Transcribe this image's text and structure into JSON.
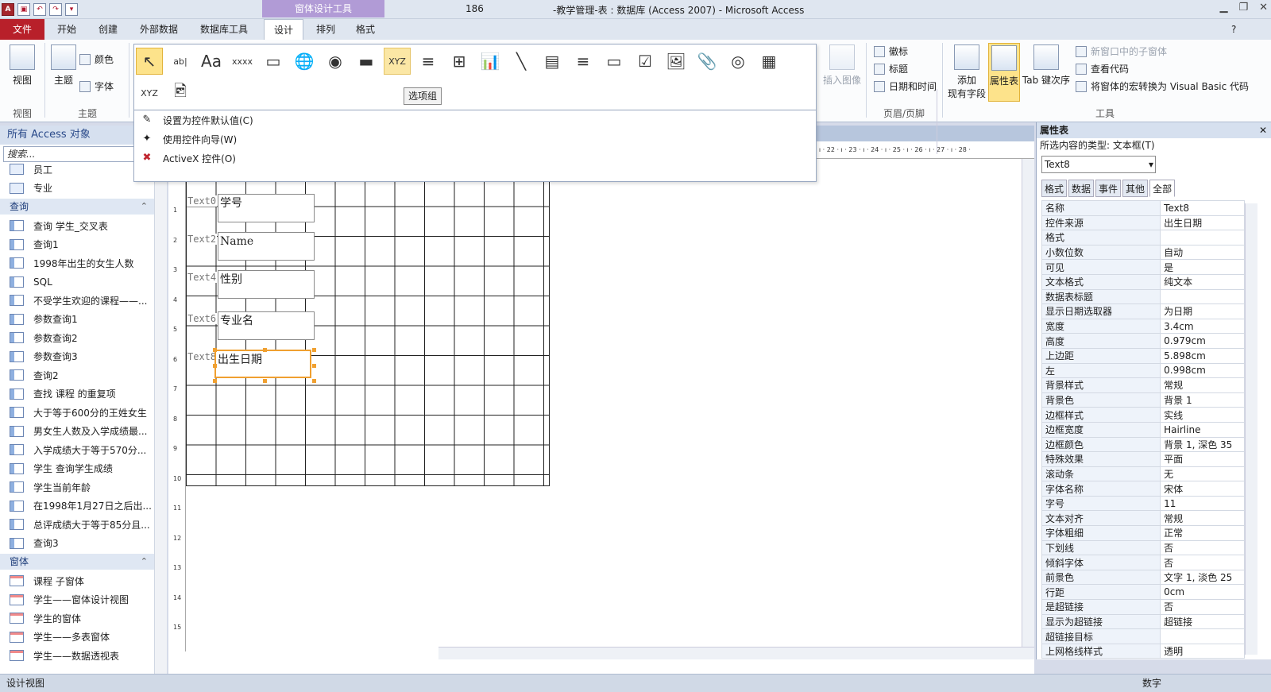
{
  "titlebar": {
    "context_tab": "窗体设计工具",
    "left_fragment": "186",
    "title": "-教学管理-表 : 数据库 (Access 2007)  -  Microsoft Access",
    "qat_app": "A",
    "min": "▁",
    "max": "❐",
    "close": "✕"
  },
  "tabs": {
    "file": "文件",
    "items": [
      "开始",
      "创建",
      "外部数据",
      "数据库工具",
      "设计",
      "排列",
      "格式"
    ],
    "help": "?"
  },
  "ribbon": {
    "view_label": "视图",
    "theme_label": "主题",
    "color_label": "颜色",
    "font_label": "字体",
    "group_view": "视图",
    "group_theme": "主题",
    "insert_image": "插入图像",
    "header_items": [
      "徽标",
      "标题",
      "日期和时间"
    ],
    "group_header": "页眉/页脚",
    "add_fields": "添加\n现有字段",
    "add_fields_line1": "添加",
    "add_fields_line2": "现有字段",
    "property_sheet": "属性表",
    "tab_order": "Tab 键次序",
    "tools_items": [
      "新窗口中的子窗体",
      "查看代码",
      "将窗体的宏转换为 Visual Basic 代码"
    ],
    "group_tools": "工具"
  },
  "gallery": {
    "controls": [
      "↖",
      "ab|",
      "Aa",
      "xxxx",
      "▭",
      "🌐",
      "◉",
      "▬",
      "XYZ",
      "≡",
      "⊞",
      "📊",
      "╲",
      "▤",
      "≡",
      "▭",
      "☑",
      "🖼",
      "📎",
      "◎",
      "▦",
      "XYZ",
      "🖻"
    ],
    "tooltip": "选项组"
  },
  "dropdown_menu": [
    {
      "icon": "✎",
      "label": "设置为控件默认值(C)"
    },
    {
      "icon": "✦",
      "label": "使用控件向导(W)"
    },
    {
      "icon": "✖",
      "label": "ActiveX 控件(O)"
    }
  ],
  "nav": {
    "header": "所有 Access 对象",
    "search_placeholder": "搜索...",
    "tables": [
      "员工",
      "专业"
    ],
    "queries_header": "查询",
    "queries": [
      "查询 学生_交叉表",
      "查询1",
      "1998年出生的女生人数",
      "SQL",
      "不受学生欢迎的课程——...",
      "参数查询1",
      "参数查询2",
      "参数查询3",
      "查询2",
      "查找 课程 的重复项",
      "大于等于600分的王姓女生",
      "男女生人数及入学成绩最...",
      "入学成绩大于等于570分...",
      "学生 查询学生成绩",
      "学生当前年龄",
      "在1998年1月27日之后出...",
      "总评成绩大于等于85分且...",
      "查询3"
    ],
    "forms_header": "窗体",
    "forms": [
      "课程 子窗体",
      "学生——窗体设计视图",
      "学生的窗体",
      "学生——多表窗体",
      "学生——数据透视表"
    ],
    "chevron": "≈"
  },
  "design": {
    "ruler_h": "· 21 · ı · 22 · ı · 23 · ı · 24 · ı · 25 · ı · 26 · ı · 27 · ı · 28 ·",
    "ruler_v": [
      "1",
      "2",
      "3",
      "4",
      "5",
      "6",
      "7",
      "8",
      "9",
      "10",
      "11",
      "12",
      "13",
      "14",
      "15"
    ],
    "fields": [
      {
        "label": "Text0",
        "value": "学号"
      },
      {
        "label": "Text2",
        "value": "Name"
      },
      {
        "label": "Text4",
        "value": "性别"
      },
      {
        "label": "Text6",
        "value": "专业名"
      },
      {
        "label": "Text8",
        "value": "出生日期"
      }
    ]
  },
  "properties": {
    "title": "属性表",
    "close": "✕",
    "selection_type": "所选内容的类型: 文本框(T)",
    "selected": "Text8",
    "tabs": [
      "格式",
      "数据",
      "事件",
      "其他",
      "全部"
    ],
    "rows": [
      [
        "名称",
        "Text8"
      ],
      [
        "控件来源",
        "出生日期"
      ],
      [
        "格式",
        ""
      ],
      [
        "小数位数",
        "自动"
      ],
      [
        "可见",
        "是"
      ],
      [
        "文本格式",
        "纯文本"
      ],
      [
        "数据表标题",
        ""
      ],
      [
        "显示日期选取器",
        "为日期"
      ],
      [
        "宽度",
        "3.4cm"
      ],
      [
        "高度",
        "0.979cm"
      ],
      [
        "上边距",
        "5.898cm"
      ],
      [
        "左",
        "0.998cm"
      ],
      [
        "背景样式",
        "常规"
      ],
      [
        "背景色",
        "背景 1"
      ],
      [
        "边框样式",
        "实线"
      ],
      [
        "边框宽度",
        "Hairline"
      ],
      [
        "边框颜色",
        "背景 1, 深色 35"
      ],
      [
        "特殊效果",
        "平面"
      ],
      [
        "滚动条",
        "无"
      ],
      [
        "字体名称",
        "宋体"
      ],
      [
        "字号",
        "11"
      ],
      [
        "文本对齐",
        "常规"
      ],
      [
        "字体粗细",
        "正常"
      ],
      [
        "下划线",
        "否"
      ],
      [
        "倾斜字体",
        "否"
      ],
      [
        "前景色",
        "文字 1, 淡色 25"
      ],
      [
        "行距",
        "0cm"
      ],
      [
        "是超链接",
        "否"
      ],
      [
        "显示为超链接",
        "超链接"
      ],
      [
        "超链接目标",
        ""
      ],
      [
        "上网格线样式",
        "透明"
      ]
    ]
  },
  "status": {
    "left": "设计视图",
    "right": "数字"
  },
  "colors": {
    "file_tab": "#b8202a",
    "context_tab": "#b19bd6",
    "selection": "#f0a030"
  }
}
